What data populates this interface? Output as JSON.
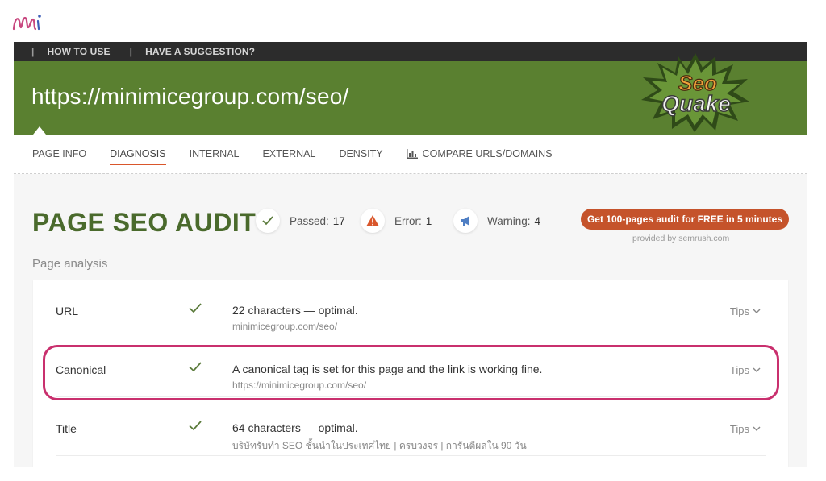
{
  "topbar": {
    "separator": "|",
    "links": [
      "HOW TO USE",
      "HAVE A SUGGESTION?"
    ]
  },
  "hero": {
    "url": "https://minimicegroup.com/seo/",
    "brand_line1": "Seo",
    "brand_line2": "Quake",
    "brand_color": "#5a8030"
  },
  "tabs": [
    {
      "label": "PAGE INFO",
      "active": false
    },
    {
      "label": "DIAGNOSIS",
      "active": true
    },
    {
      "label": "INTERNAL",
      "active": false
    },
    {
      "label": "EXTERNAL",
      "active": false
    },
    {
      "label": "DENSITY",
      "active": false
    },
    {
      "label": "COMPARE URLS/DOMAINS",
      "active": false,
      "icon": "bar-chart-icon"
    }
  ],
  "audit": {
    "title": "PAGE SEO AUDIT",
    "passed_label": "Passed:",
    "passed_count": "17",
    "error_label": "Error:",
    "error_count": "1",
    "warning_label": "Warning:",
    "warning_count": "4",
    "cta_label": "Get 100-pages audit for FREE in 5 minutes",
    "provided_by": "provided by  semrush.com",
    "accent_color": "#c5532b"
  },
  "analysis": {
    "section_label": "Page analysis",
    "rows": [
      {
        "name": "URL",
        "status": "passed",
        "main": "22 characters — optimal.",
        "sub": "minimicegroup.com/seo/",
        "tips": "Tips"
      },
      {
        "name": "Canonical",
        "status": "passed",
        "main": "A canonical tag is set for this page and the link is working fine.",
        "sub": "https://minimicegroup.com/seo/",
        "tips": "Tips"
      },
      {
        "name": "Title",
        "status": "passed",
        "main": "64 characters — optimal.",
        "sub": "บริษัทรับทำ SEO ชั้นนำในประเทศไทย | ครบวงจร | การันตีผลใน 90 วัน",
        "tips": "Tips"
      }
    ]
  },
  "highlight_color": "#c9306e"
}
